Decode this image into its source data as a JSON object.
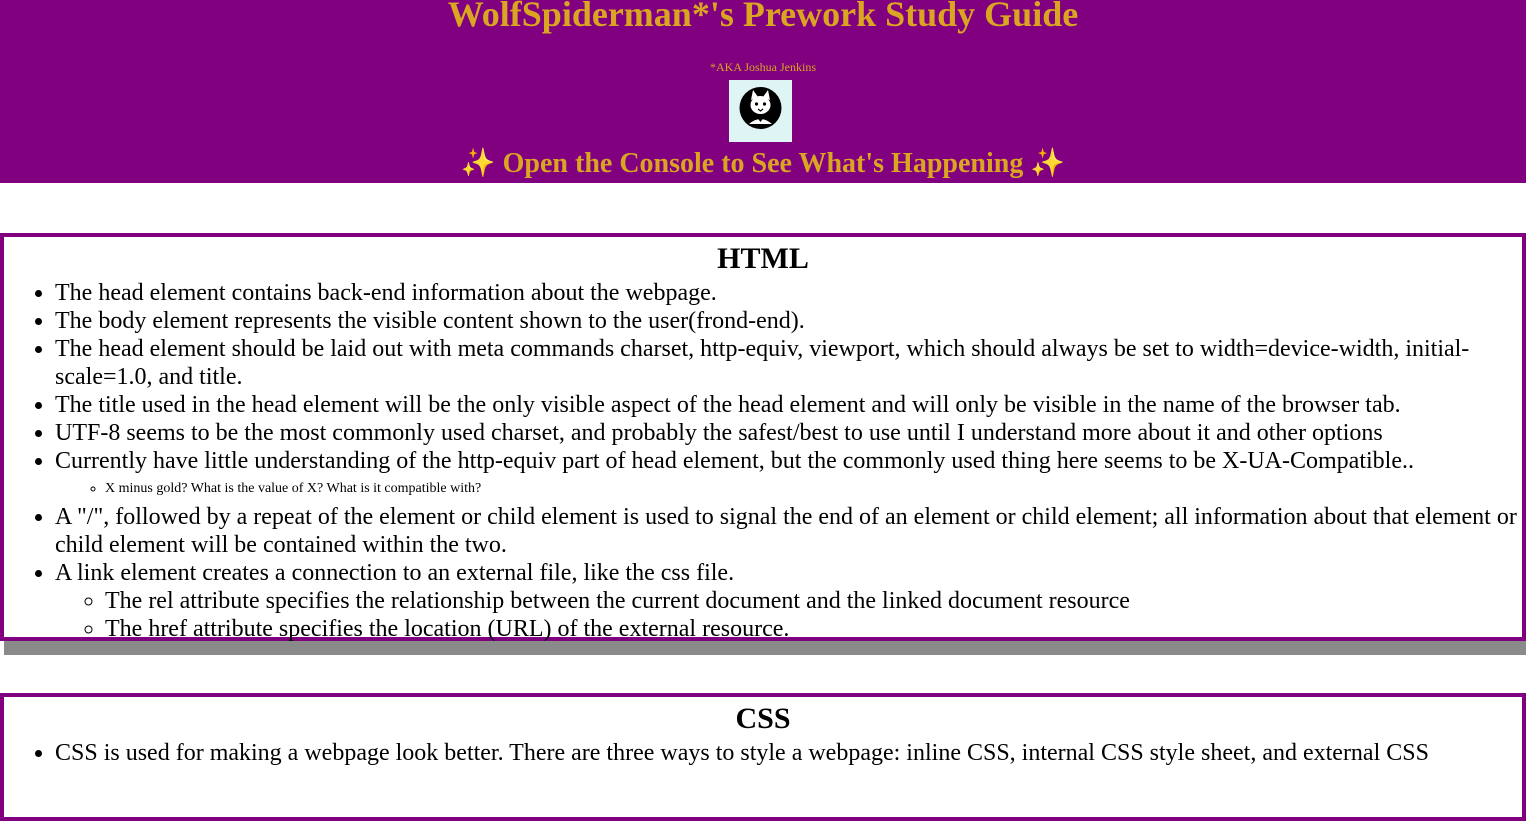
{
  "header": {
    "title": "WolfSpiderman*'s Prework Study Guide",
    "aka": "*AKA Joshua Jenkins",
    "console_note_left": "✨",
    "console_note_text": " Open the Console to See What's Happening ",
    "console_note_right": "✨",
    "avatar_icon": "cat-avatar-icon",
    "background_color": "#800080",
    "title_color": "#daa520"
  },
  "html_section": {
    "heading": "HTML",
    "items": [
      "The head element contains back-end information about the webpage.",
      "The body element represents the visible content shown to the user(frond-end).",
      "The head element should be laid out with meta commands charset, http-equiv, viewport, which should always be set to width=device-width, initial-scale=1.0, and title.",
      "The title used in the head element will be the only visible aspect of the head element and will only be visible in the name of the browser tab.",
      "UTF-8 seems to be the most commonly used charset, and probably the safest/best to use until I understand more about it and other options",
      "Currently have little understanding of the http-equiv part of head element, but the commonly used thing here seems to be X-UA-Compatible..",
      "A \"/\", followed by a repeat of the element or child element is used to signal the end of an element or child element; all information about that element or child element will be contained within the two.",
      "A link element creates a connection to an external file, like the css file."
    ],
    "sub_note": "X minus gold? What is the value of X? What is it compatible with?",
    "link_subitems": [
      "The rel attribute specifies the relationship between the current document and the linked document resource",
      "The href attribute specifies the location (URL) of the external resource."
    ]
  },
  "css_section": {
    "heading": "CSS",
    "items": [
      "CSS is used for making a webpage look better. There are three ways to style a webpage: inline CSS, internal CSS style sheet, and external CSS"
    ]
  }
}
